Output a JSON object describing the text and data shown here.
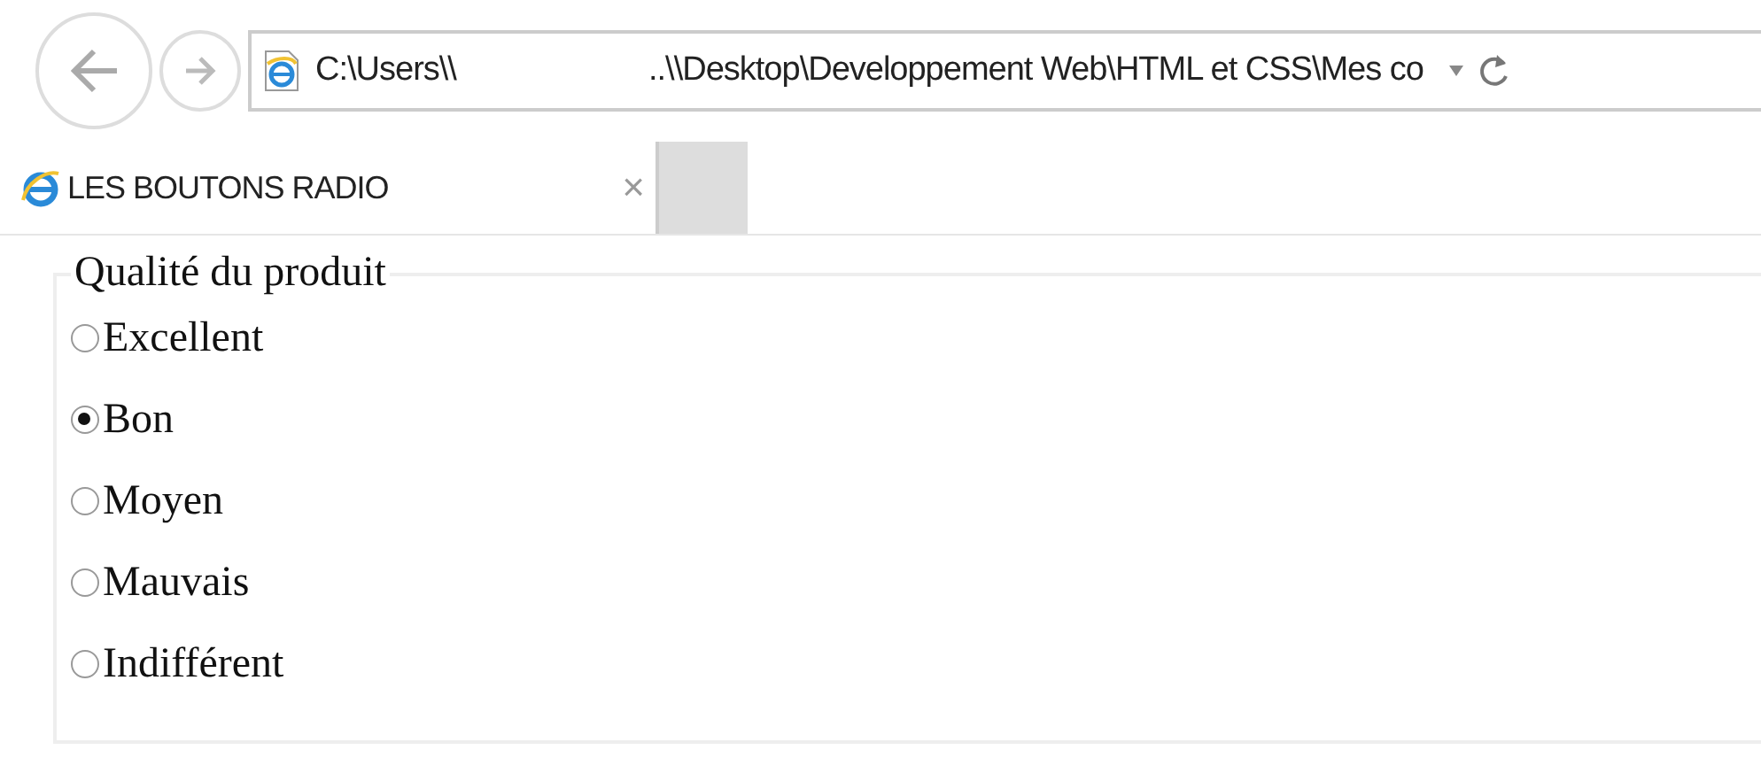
{
  "address_bar": {
    "path_start": "C:\\Users\\\\",
    "path_end": "..\\\\Desktop\\Developpement Web\\HTML et CSS\\Mes co"
  },
  "tabs": [
    {
      "title": "LES BOUTONS RADIO",
      "close": "×",
      "selected": true
    }
  ],
  "fieldset": {
    "legend": "Qualité du produit",
    "options": [
      {
        "label": "Excellent",
        "selected": false
      },
      {
        "label": "Bon",
        "selected": true
      },
      {
        "label": "Moyen",
        "selected": false
      },
      {
        "label": "Mauvais",
        "selected": false
      },
      {
        "label": "Indifférent",
        "selected": false
      }
    ]
  }
}
